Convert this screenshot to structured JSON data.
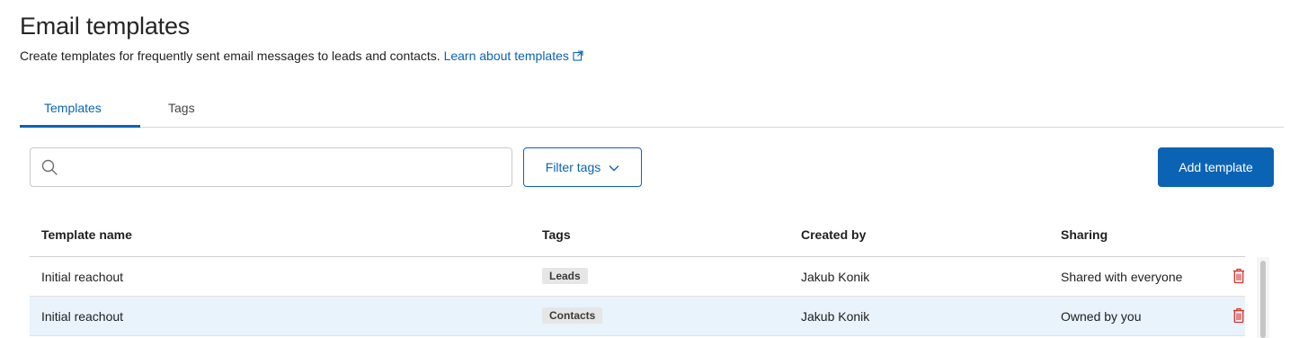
{
  "header": {
    "title": "Email templates",
    "description": "Create templates for frequently sent email messages to leads and contacts.",
    "learn_link": "Learn about templates"
  },
  "tabs": [
    {
      "label": "Templates",
      "active": true
    },
    {
      "label": "Tags",
      "active": false
    }
  ],
  "toolbar": {
    "search_placeholder": "",
    "search_value": "",
    "filter_label": "Filter tags",
    "add_label": "Add template"
  },
  "table": {
    "columns": [
      "Template name",
      "Tags",
      "Created by",
      "Sharing"
    ],
    "rows": [
      {
        "name": "Initial reachout",
        "tag": "Leads",
        "created_by": "Jakub Konik",
        "sharing": "Shared with everyone"
      },
      {
        "name": "Initial reachout",
        "tag": "Contacts",
        "created_by": "Jakub Konik",
        "sharing": "Owned by you"
      }
    ]
  },
  "colors": {
    "accent": "#0b63b4",
    "danger": "#d9302c",
    "selected_row": "#e8f3fb",
    "tag_bg": "#e6e6e6"
  },
  "icons": {
    "search": "search-icon",
    "external_link": "external-link-icon",
    "chevron": "chevron-down-icon",
    "delete": "trash-icon"
  }
}
